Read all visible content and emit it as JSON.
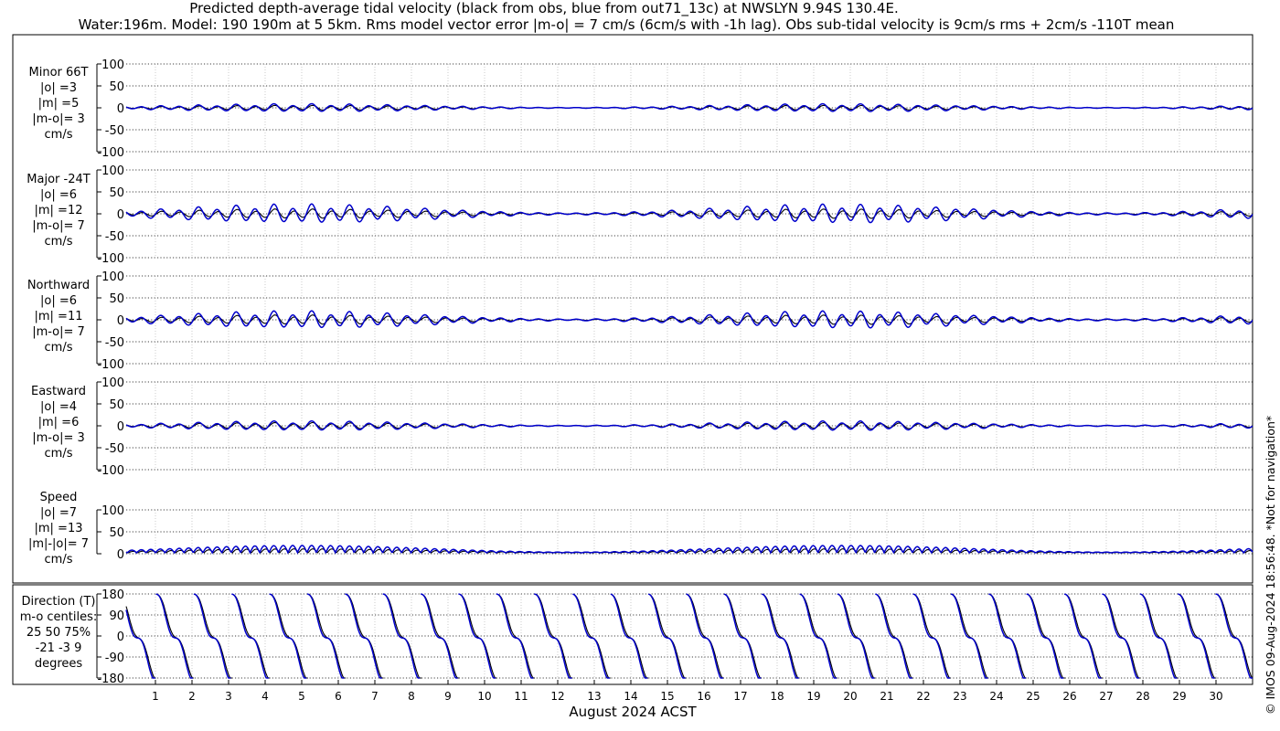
{
  "title_line1": "Predicted depth-average tidal velocity (black from obs, blue from out71_13c) at NWSLYN 9.94S 130.4E.",
  "title_line2": "Water:196m. Model: 190 190m at 5 5km. Rms model vector error |m-o| = 7 cm/s (6cm/s with -1h lag). Obs sub-tidal velocity is 9cm/s rms + 2cm/s -110T mean",
  "copyright": "© IMOS 09-Aug-2024 18:56:48. *Not for navigation*",
  "xlabel": "August 2024 ACST",
  "colors": {
    "obs": "#000000",
    "model": "#0000cc"
  },
  "chart_data": [
    {
      "type": "line",
      "panel": "minor",
      "side_label": [
        "Minor 66T",
        "|o| =3",
        "|m| =5",
        "|m-o|= 3",
        "cm/s"
      ],
      "ylim": [
        -100,
        100
      ],
      "yticks": [
        100,
        50,
        0,
        -50,
        -100
      ],
      "series": [
        {
          "kind": "obs",
          "amplitude": 3
        },
        {
          "kind": "model",
          "amplitude": 5
        }
      ]
    },
    {
      "type": "line",
      "panel": "major",
      "side_label": [
        "Major -24T",
        "|o| =6",
        "|m| =12",
        "|m-o|= 7",
        "cm/s"
      ],
      "ylim": [
        -100,
        100
      ],
      "yticks": [
        100,
        50,
        0,
        -50,
        -100
      ],
      "series": [
        {
          "kind": "obs",
          "amplitude": 6
        },
        {
          "kind": "model",
          "amplitude": 12
        }
      ]
    },
    {
      "type": "line",
      "panel": "northward",
      "side_label": [
        "Northward",
        "|o| =6",
        "|m| =11",
        "|m-o|= 7",
        "cm/s"
      ],
      "ylim": [
        -100,
        100
      ],
      "yticks": [
        100,
        50,
        0,
        -50,
        -100
      ],
      "series": [
        {
          "kind": "obs",
          "amplitude": 6
        },
        {
          "kind": "model",
          "amplitude": 11
        }
      ]
    },
    {
      "type": "line",
      "panel": "eastward",
      "side_label": [
        "Eastward",
        "|o| =4",
        "|m| =6",
        "|m-o|= 3",
        "cm/s"
      ],
      "ylim": [
        -100,
        100
      ],
      "yticks": [
        100,
        50,
        0,
        -50,
        -100
      ],
      "series": [
        {
          "kind": "obs",
          "amplitude": 4
        },
        {
          "kind": "model",
          "amplitude": 6
        }
      ]
    },
    {
      "type": "line",
      "panel": "speed",
      "side_label": [
        "Speed",
        "|o| =7",
        "|m| =13",
        "|m|-|o|= 7",
        "cm/s"
      ],
      "ylim": [
        0,
        100
      ],
      "yticks": [
        100,
        50,
        0
      ],
      "series": [
        {
          "kind": "obs",
          "amplitude": 7
        },
        {
          "kind": "model",
          "amplitude": 13
        }
      ]
    },
    {
      "type": "line",
      "panel": "direction",
      "side_label": [
        "Direction (T)",
        "m-o centiles:",
        "25  50  75%",
        "-21  -3   9",
        "degrees"
      ],
      "ylim": [
        -180,
        180
      ],
      "yticks": [
        180,
        90,
        0,
        -90,
        -180
      ],
      "series": [
        {
          "kind": "obs"
        },
        {
          "kind": "model"
        }
      ]
    }
  ],
  "x_axis": {
    "days": [
      "1",
      "2",
      "3",
      "4",
      "5",
      "6",
      "7",
      "8",
      "9",
      "10",
      "11",
      "12",
      "13",
      "14",
      "15",
      "16",
      "17",
      "18",
      "19",
      "20",
      "21",
      "22",
      "23",
      "24",
      "25",
      "26",
      "27",
      "28",
      "29",
      "30"
    ],
    "range_days": [
      0.2,
      31
    ]
  }
}
